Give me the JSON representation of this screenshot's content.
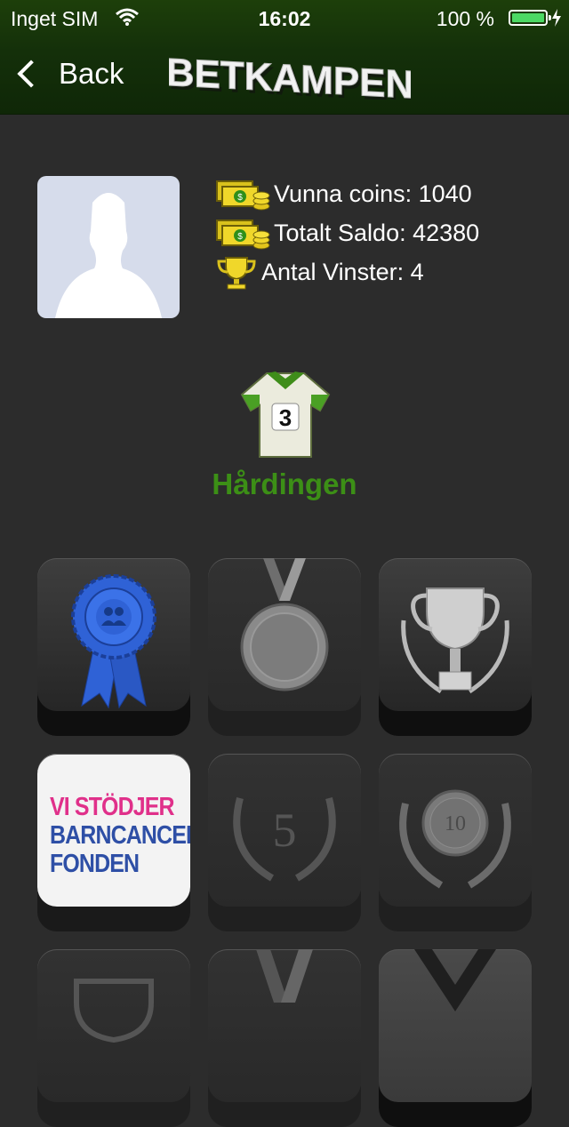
{
  "status_bar": {
    "carrier": "Inget SIM",
    "time": "16:02",
    "battery_percent": "100 %",
    "battery_level": 1.0
  },
  "nav": {
    "back_label": "Back",
    "brand": "BETKAMPEN"
  },
  "profile": {
    "stats": [
      {
        "icon": "coins-icon",
        "text": "Vunna coins: 1040"
      },
      {
        "icon": "coins-icon",
        "text": "Totalt Saldo: 42380"
      },
      {
        "icon": "trophy-icon",
        "text": "Antal Vinster: 4"
      }
    ],
    "jersey_number": "3",
    "rank_title": "Hårdingen"
  },
  "badges": {
    "charity": {
      "line1": "VI STÖDJER",
      "line2": "BARNCANCER",
      "line3": "FONDEN"
    },
    "five_label": "5",
    "ten_label": "10"
  },
  "colors": {
    "nav_green": "#14300a",
    "rank_green": "#3c8f16",
    "battery_green": "#4cd964",
    "ribbon_blue": "#2f62d6"
  }
}
